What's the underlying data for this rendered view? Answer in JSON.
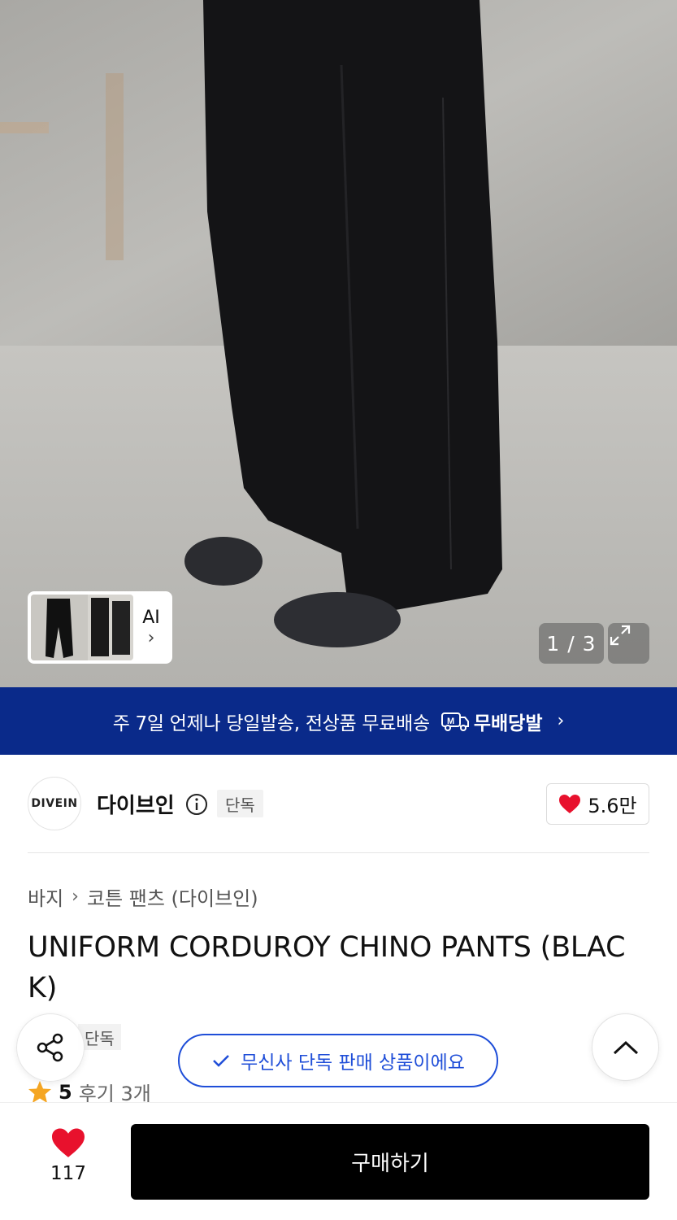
{
  "gallery": {
    "ai_label": "AI",
    "counter": "1 / 3"
  },
  "banner": {
    "text": "주 7일 언제나 당일발송, 전상품 무료배송",
    "logo_text": "무배당발",
    "logo_badge": "M"
  },
  "brand": {
    "logo_text": "DIVEIN",
    "name": "다이브인",
    "tag": "단독",
    "likes": "5.6만"
  },
  "breadcrumb": [
    "바지",
    "코튼 팬츠 (다이브인)"
  ],
  "product": {
    "title": "UNIFORM CORDUROY CHINO PANTS (BLACK)",
    "exclusive_tag": "단독",
    "rating": "5",
    "reviews": "후기 3개"
  },
  "toast": {
    "text": "무신사 단독 판매 상품이에요"
  },
  "bottom": {
    "wish_count": "117",
    "buy_label": "구매하기"
  },
  "colors": {
    "banner_bg": "#0a2a8a",
    "accent_blue": "#1f4ed8",
    "heart_red": "#e8112d",
    "star_orange": "#f5a623"
  }
}
